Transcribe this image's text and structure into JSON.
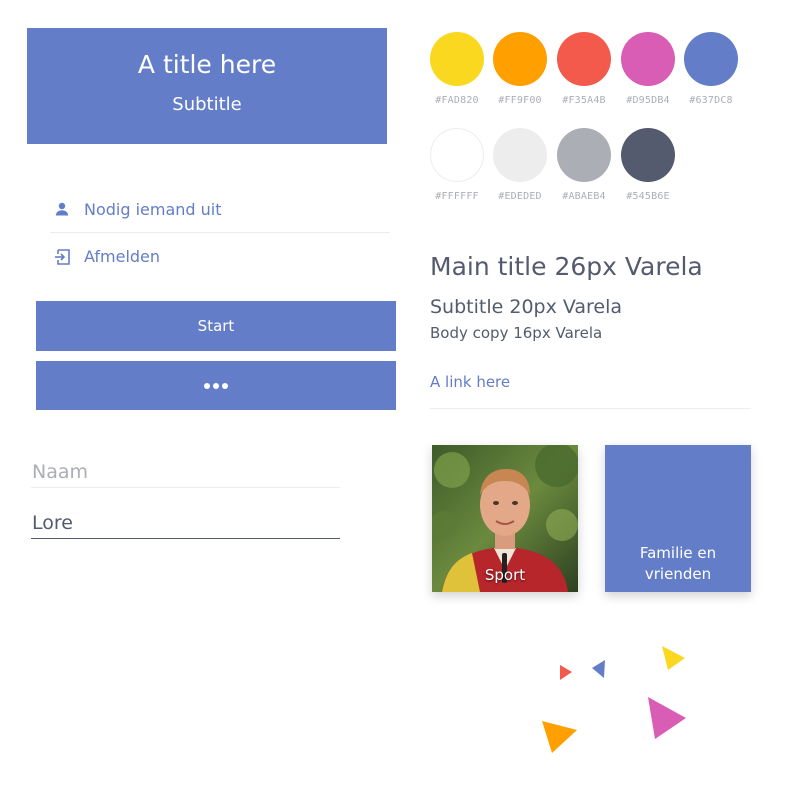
{
  "header": {
    "title": "A title here",
    "subtitle": "Subtitle"
  },
  "menu": {
    "items": [
      {
        "label": "Nodig iemand uit",
        "icon": "person-icon"
      },
      {
        "label": "Afmelden",
        "icon": "logout-icon"
      }
    ]
  },
  "buttons": {
    "start_label": "Start",
    "more_icon": "more-dots-icon"
  },
  "form": {
    "naam": {
      "placeholder": "Naam",
      "value": ""
    },
    "second": {
      "placeholder": "",
      "value": "Lore"
    }
  },
  "palette": [
    {
      "hex": "#FAD820",
      "color": "#FAD820"
    },
    {
      "hex": "#FF9F00",
      "color": "#FF9F00"
    },
    {
      "hex": "#F35A4B",
      "color": "#F35A4B"
    },
    {
      "hex": "#D95DB4",
      "color": "#D95DB4"
    },
    {
      "hex": "#637DC8",
      "color": "#637DC8"
    },
    {
      "hex": "#FFFFFF",
      "color": "#FFFFFF"
    },
    {
      "hex": "#EDEDED",
      "color": "#EDEDED"
    },
    {
      "hex": "#ABAEB4",
      "color": "#ABAEB4"
    },
    {
      "hex": "#545B6E",
      "color": "#545B6E"
    }
  ],
  "typography": {
    "main_title": "Main title 26px Varela",
    "subtitle": "Subtitle 20px Varela",
    "body": "Body copy 16px Varela",
    "link": "A link here"
  },
  "tiles": [
    {
      "label": "Sport",
      "image": "person-photo"
    },
    {
      "label_line1": "Familie en",
      "label_line2": "vrienden"
    }
  ],
  "colors": {
    "accent": "#637DC8",
    "text": "#545B6E",
    "muted": "#ABAEB4",
    "border": "#EDEDED"
  }
}
